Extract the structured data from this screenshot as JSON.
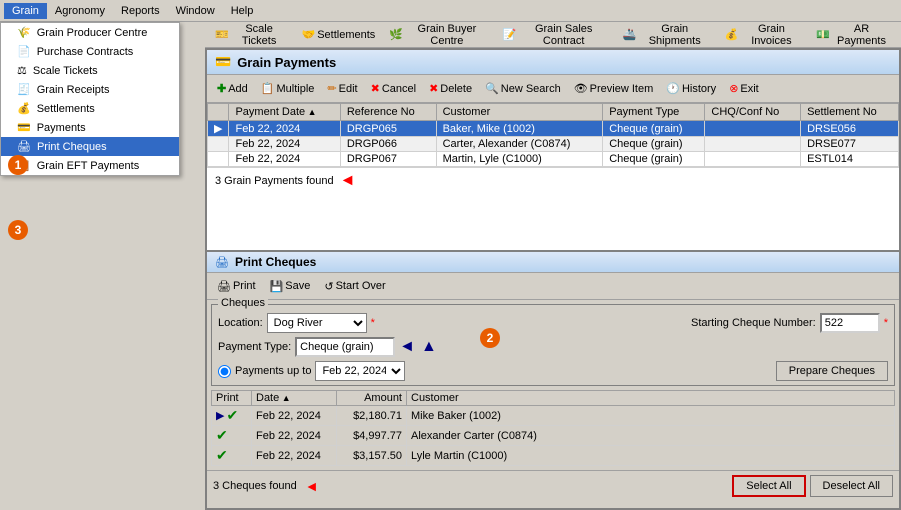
{
  "app": {
    "title": "Grain Producer Centre"
  },
  "menubar": {
    "items": [
      "Grain",
      "Agronomy",
      "Reports",
      "Window",
      "Help"
    ]
  },
  "grain_menu": {
    "items": [
      {
        "label": "Grain Producer Centre",
        "icon": "🌾"
      },
      {
        "label": "Purchase Contracts",
        "icon": "📄"
      },
      {
        "label": "Scale Tickets",
        "icon": "⚖"
      },
      {
        "label": "Grain Receipts",
        "icon": "🧾"
      },
      {
        "label": "Settlements",
        "icon": "💰"
      },
      {
        "label": "Payments",
        "icon": "💳"
      },
      {
        "label": "Print Cheques",
        "icon": "🖨",
        "selected": true
      },
      {
        "label": "Grain EFT Payments",
        "icon": "📋"
      }
    ]
  },
  "toolbar_buttons": [
    {
      "label": "Scale Tickets"
    },
    {
      "label": "Settlements"
    },
    {
      "label": "Grain Buyer Centre"
    },
    {
      "label": "Grain Sales Contract"
    },
    {
      "label": "Grain Shipments"
    },
    {
      "label": "Grain Invoices"
    },
    {
      "label": "AR Payments"
    }
  ],
  "grain_payments": {
    "title": "Grain Payments",
    "buttons": [
      "Add",
      "Multiple",
      "Edit",
      "Cancel",
      "Delete",
      "New Search",
      "Preview Item",
      "History",
      "Exit"
    ],
    "table": {
      "columns": [
        "Payment Date",
        "Reference No",
        "Customer",
        "Payment Type",
        "CHQ/Conf No",
        "Settlement No"
      ],
      "rows": [
        {
          "date": "Feb 22, 2024",
          "ref": "DRGP065",
          "customer": "Baker, Mike (1002)",
          "type": "Cheque (grain)",
          "chq": "",
          "settlement": "DRSE056",
          "selected": true
        },
        {
          "date": "Feb 22, 2024",
          "ref": "DRGP066",
          "customer": "Carter, Alexander (C0874)",
          "type": "Cheque (grain)",
          "chq": "",
          "settlement": "DRSE077"
        },
        {
          "date": "Feb 22, 2024",
          "ref": "DRGP067",
          "customer": "Martin, Lyle (C1000)",
          "type": "Cheque (grain)",
          "chq": "",
          "settlement": "ESTL014"
        }
      ]
    },
    "found_text": "3 Grain Payments found"
  },
  "print_cheques": {
    "title": "Print Cheques",
    "toolbar": [
      "Print",
      "Save",
      "Start Over"
    ],
    "cheques_label": "Cheques",
    "location_label": "Location:",
    "location_value": "Dog River",
    "location_options": [
      "Dog River"
    ],
    "payment_type_label": "Payment Type:",
    "payment_type_value": "Cheque (grain)",
    "payments_up_to_label": "Payments up to",
    "payments_up_to_value": "Feb 22, 2024",
    "starting_cheque_label": "Starting Cheque Number:",
    "starting_cheque_value": "522",
    "prepare_btn": "Prepare Cheques",
    "table": {
      "columns": [
        "Print",
        "Date",
        "Amount",
        "Customer"
      ],
      "rows": [
        {
          "print": true,
          "date": "Feb 22, 2024",
          "amount": "$2,180.71",
          "customer": "Mike Baker (1002)"
        },
        {
          "print": true,
          "date": "Feb 22, 2024",
          "amount": "$4,997.77",
          "customer": "Alexander Carter (C0874)"
        },
        {
          "print": true,
          "date": "Feb 22, 2024",
          "amount": "$3,157.50",
          "customer": "Lyle Martin (C1000)"
        }
      ]
    },
    "found_text": "3 Cheques found",
    "select_all": "Select All",
    "deselect_all": "Deselect All"
  },
  "badges": {
    "b1": "1",
    "b2": "2",
    "b3": "3"
  },
  "colors": {
    "selected_row": "#316ac5",
    "header_gradient_start": "#dce8f8",
    "header_gradient_end": "#b8d4f0",
    "red": "#cc0000"
  }
}
